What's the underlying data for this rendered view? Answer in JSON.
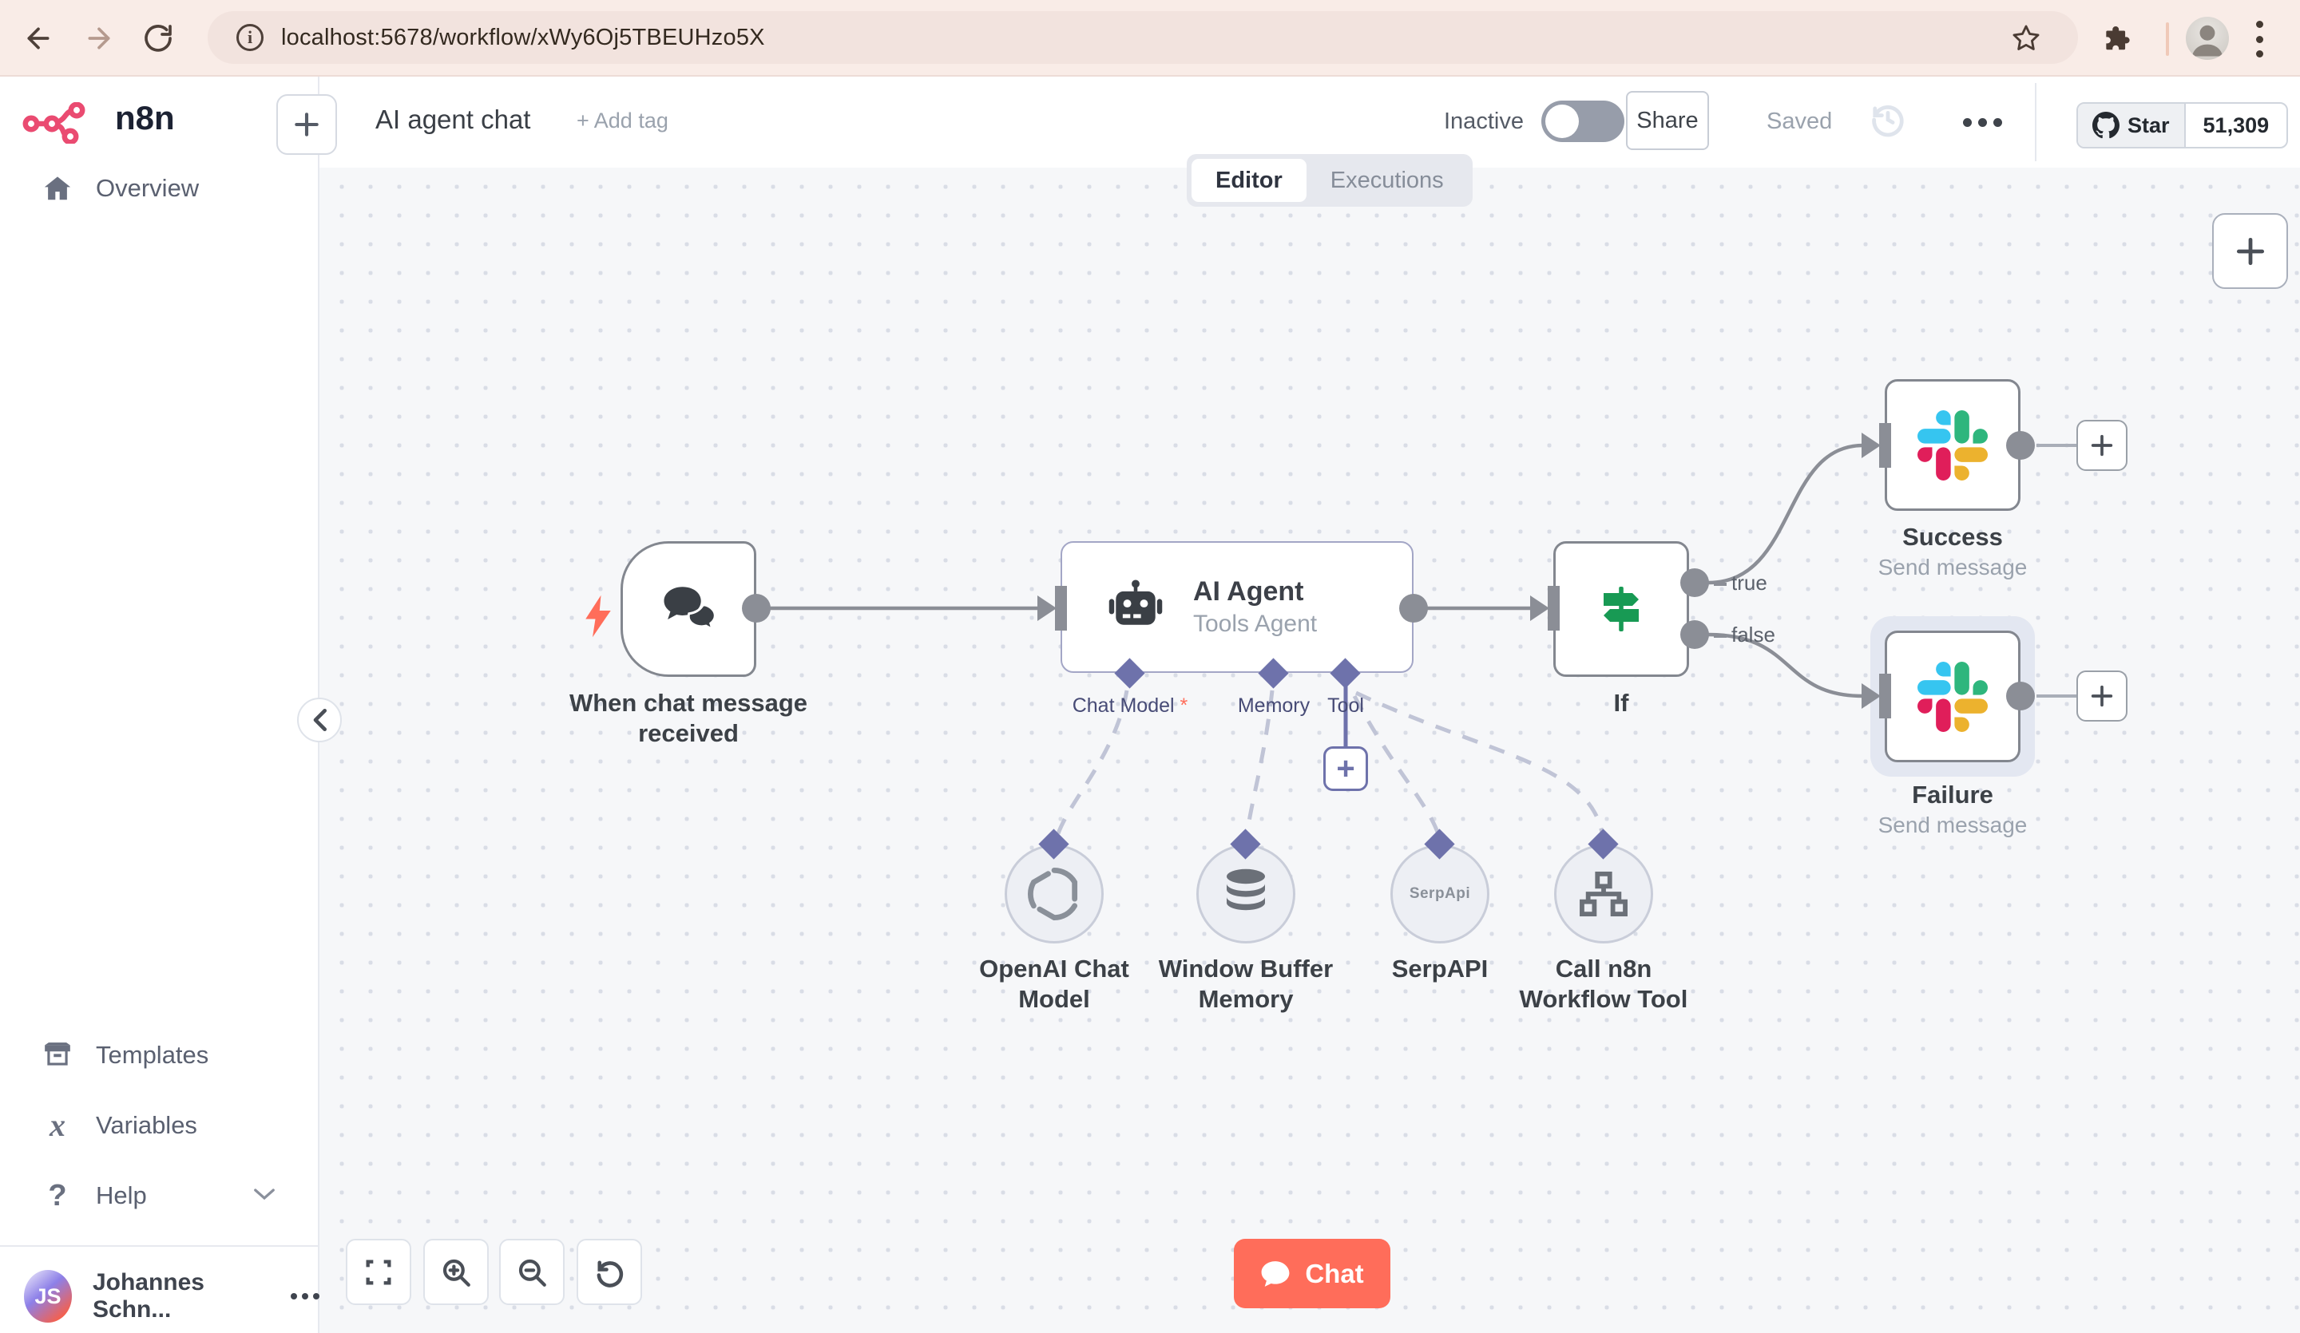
{
  "browser": {
    "url": "localhost:5678/workflow/xWy6Oj5TBEUHzo5X"
  },
  "sidebar": {
    "logo_text": "n8n",
    "items": [
      {
        "label": "Overview"
      },
      {
        "label": "Templates"
      },
      {
        "label": "Variables"
      },
      {
        "label": "Help"
      }
    ],
    "user": {
      "initials": "JS",
      "name": "Johannes Schn...",
      "menu": "..."
    }
  },
  "header": {
    "title": "AI agent chat",
    "add_tag": "+ Add tag",
    "status_label": "Inactive",
    "share_label": "Share",
    "saved_label": "Saved",
    "github": {
      "star_label": "Star",
      "star_count": "51,309"
    }
  },
  "tabs": {
    "editor": "Editor",
    "executions": "Executions"
  },
  "canvas": {
    "trigger": {
      "label": "When chat message received"
    },
    "agent": {
      "title": "AI Agent",
      "subtitle": "Tools Agent",
      "ports": [
        {
          "label": "Chat Model",
          "required_marker": "*"
        },
        {
          "label": "Memory"
        },
        {
          "label": "Tool"
        }
      ]
    },
    "if_node": {
      "label": "If",
      "output_true": "true",
      "output_false": "false"
    },
    "success": {
      "label": "Success",
      "subtitle": "Send message"
    },
    "failure": {
      "label": "Failure",
      "subtitle": "Send message"
    },
    "sub_nodes": [
      {
        "label": "OpenAI Chat Model"
      },
      {
        "label": "Window Buffer Memory"
      },
      {
        "label": "SerpAPI",
        "logo_text": "SerpApi"
      },
      {
        "label": "Call n8n Workflow Tool"
      }
    ],
    "chat_button": "Chat"
  },
  "colors": {
    "accent_coral": "#ff6d5a",
    "n8n_pink": "#ea4b71",
    "connector_gray": "#8b8e96",
    "port_purple": "#6e72ab",
    "if_green": "#189a54",
    "slack_blue": "#36C5F0",
    "slack_green": "#2EB67D",
    "slack_red": "#E01E5A",
    "slack_yellow": "#ECB22E"
  }
}
